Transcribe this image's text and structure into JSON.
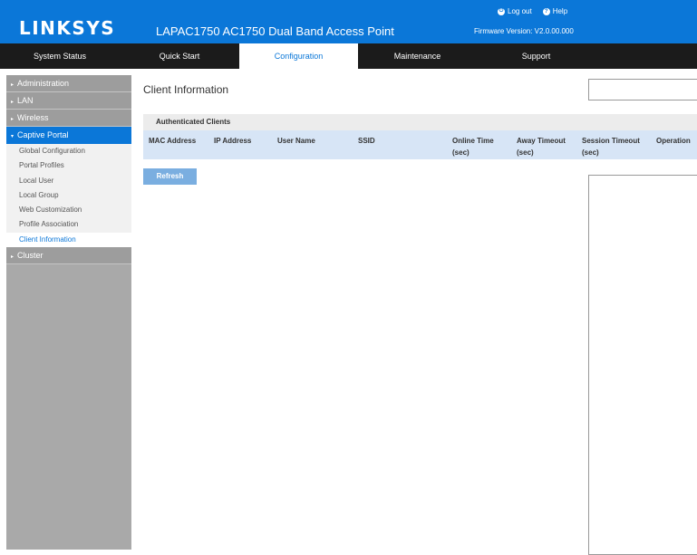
{
  "header": {
    "logo": "LINKSYS",
    "product": "LAPAC1750 AC1750 Dual Band Access Point",
    "logout_label": "Log out",
    "help_label": "Help",
    "firmware": "Firmware Version: V2.0.00.000",
    "colors": {
      "brand": "#0b77d8",
      "nav_bg": "#1b1b1b"
    }
  },
  "nav": {
    "tabs": [
      {
        "label": "System Status"
      },
      {
        "label": "Quick Start"
      },
      {
        "label": "Configuration",
        "active": true
      },
      {
        "label": "Maintenance"
      },
      {
        "label": "Support"
      }
    ]
  },
  "sidebar": {
    "groups": [
      {
        "label": "Administration"
      },
      {
        "label": "LAN"
      },
      {
        "label": "Wireless"
      },
      {
        "label": "Captive Portal",
        "open": true
      },
      {
        "label": "Cluster"
      }
    ],
    "captive_portal_items": [
      {
        "label": "Global Configuration"
      },
      {
        "label": "Portal Profiles"
      },
      {
        "label": "Local User"
      },
      {
        "label": "Local Group"
      },
      {
        "label": "Web Customization"
      },
      {
        "label": "Profile Association"
      },
      {
        "label": "Client Information",
        "active": true
      }
    ]
  },
  "main": {
    "title": "Client Information",
    "section_title": "Authenticated Clients",
    "columns": [
      {
        "line1": "MAC Address",
        "line2": ""
      },
      {
        "line1": "IP Address",
        "line2": ""
      },
      {
        "line1": "User Name",
        "line2": ""
      },
      {
        "line1": "SSID",
        "line2": ""
      },
      {
        "line1": "Online Time",
        "line2": "(sec)"
      },
      {
        "line1": "Away Timeout",
        "line2": "(sec)"
      },
      {
        "line1": "Session Timeout",
        "line2": "(sec)"
      },
      {
        "line1": "Operation",
        "line2": ""
      }
    ],
    "refresh_label": "Refresh"
  }
}
